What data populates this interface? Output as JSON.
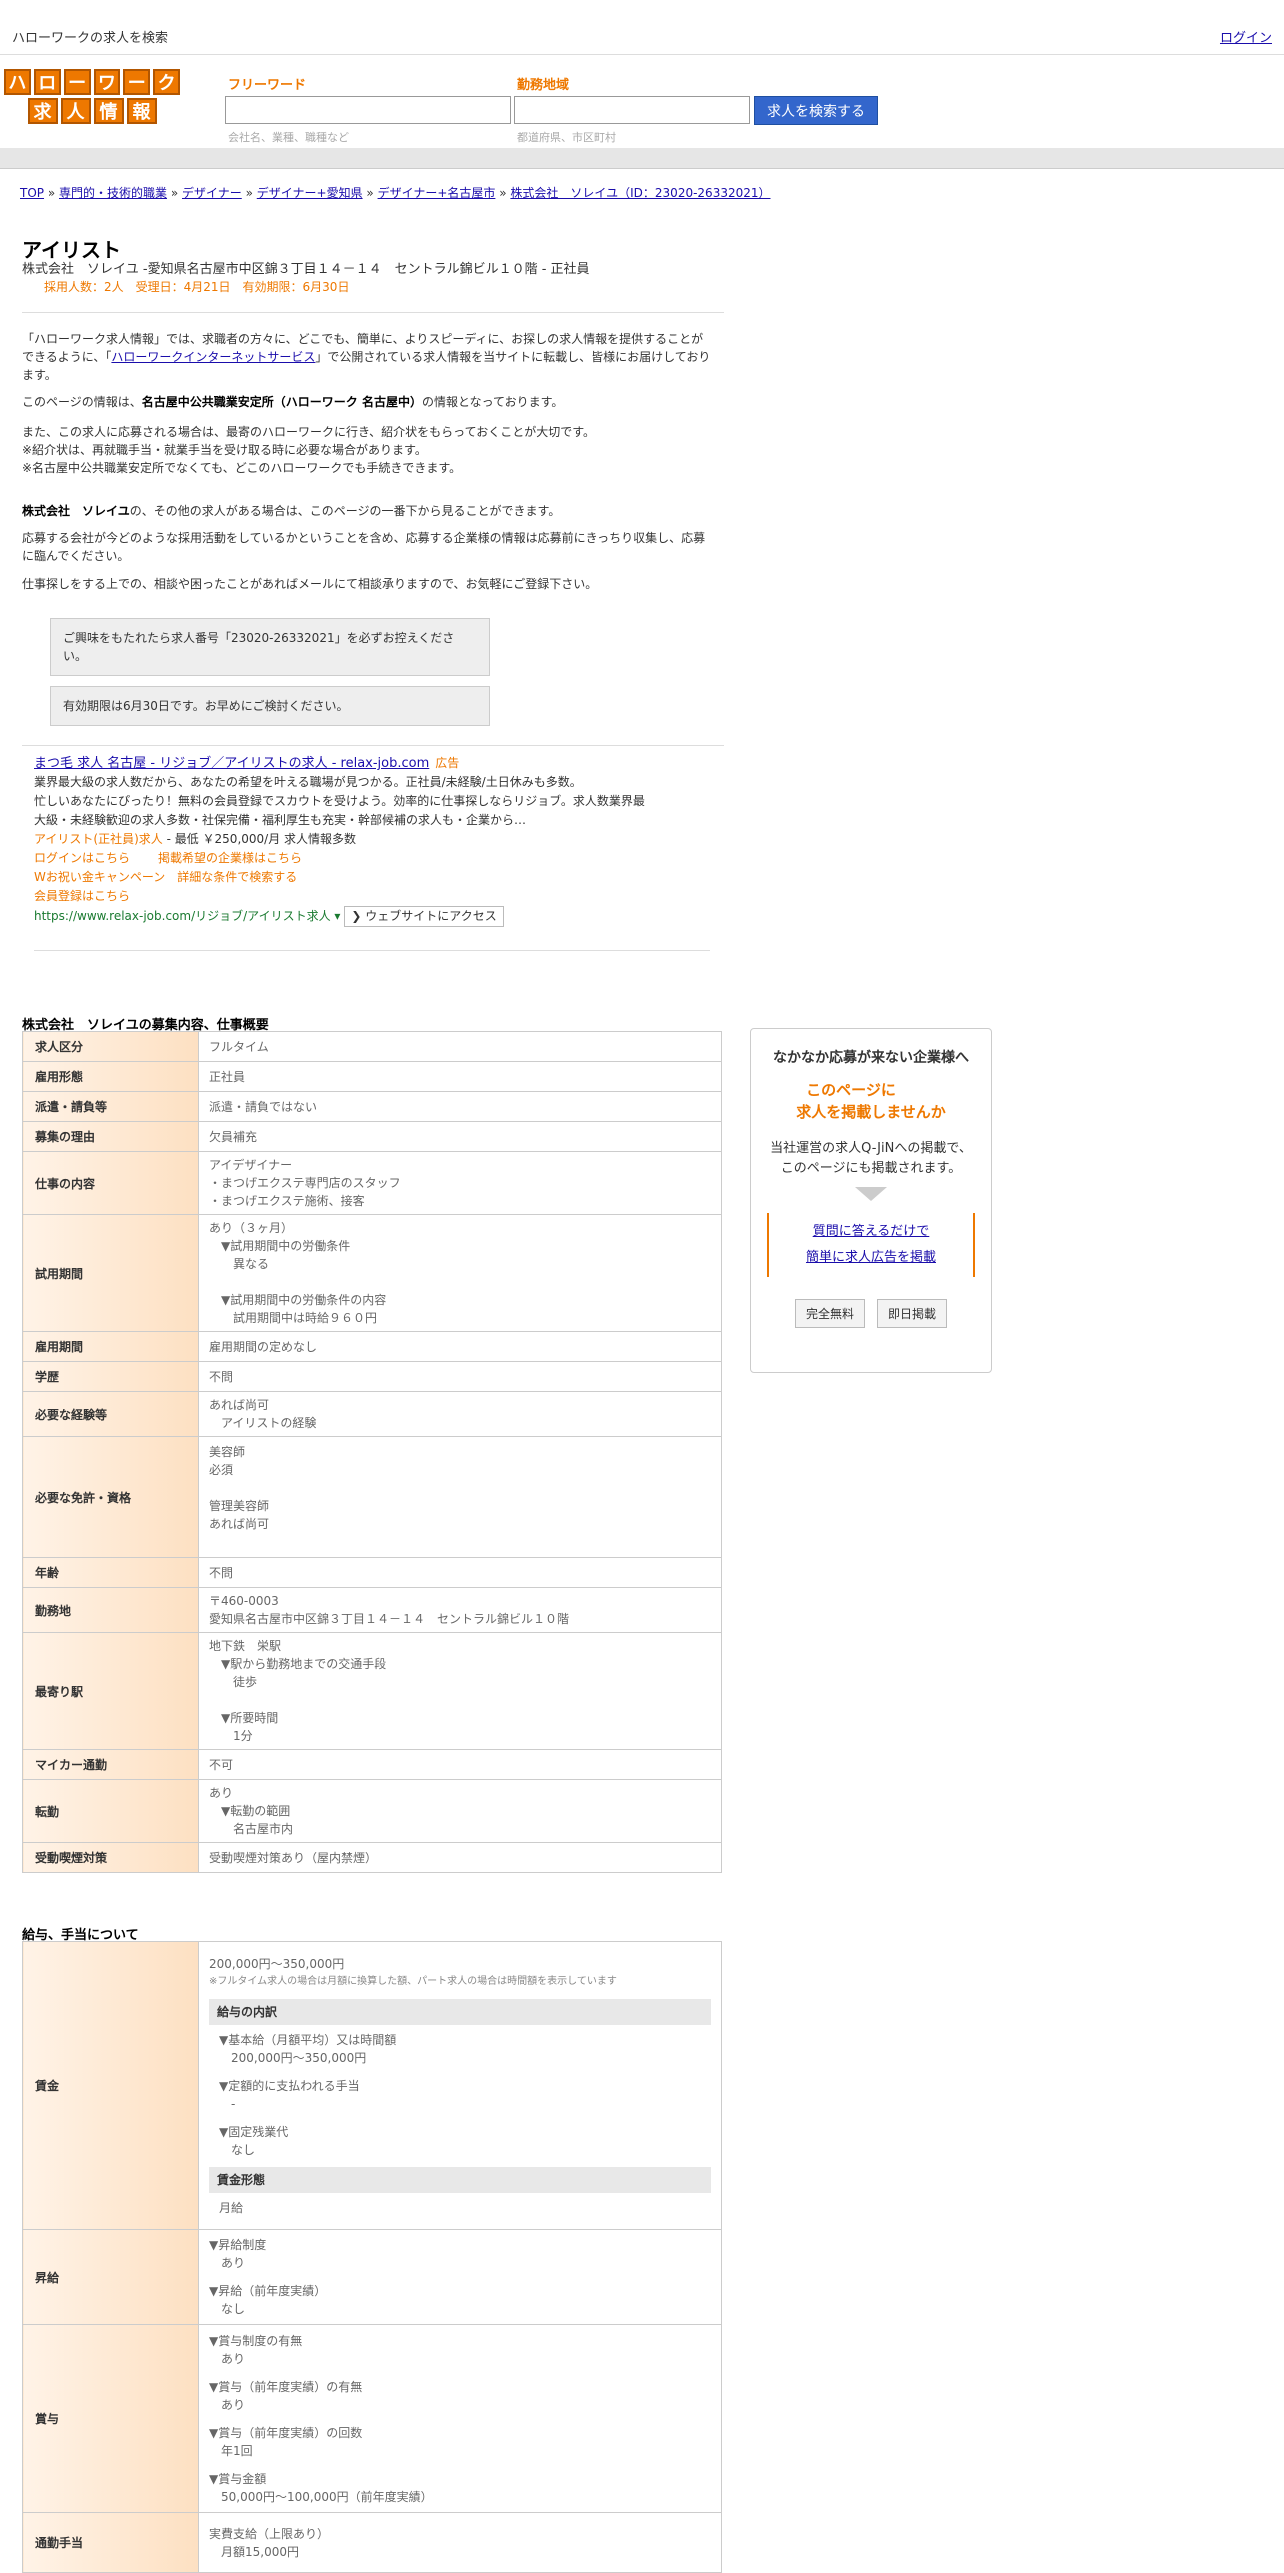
{
  "topbar": {
    "title": "ハローワークの求人を検索",
    "login": "ログイン"
  },
  "logo": {
    "row1": [
      "ハ",
      "ロ",
      "ー",
      "ワ",
      "ー",
      "ク"
    ],
    "row2": [
      "求",
      "人",
      "情",
      "報"
    ]
  },
  "search": {
    "keyword_label": "フリーワード",
    "keyword_placeholder": "会社名、業種、職種など",
    "area_label": "勤務地域",
    "area_placeholder": "都道府県、市区町村",
    "button": "求人を検索する"
  },
  "breadcrumb": [
    "TOP",
    "専門的・技術的職業",
    "デザイナー",
    "デザイナー+愛知県",
    "デザイナー+名古屋市",
    "株式会社　ソレイユ（ID：23020-26332021）"
  ],
  "job": {
    "title": "アイリスト",
    "company": "株式会社　ソレイユ -愛知県名古屋市中区錦３丁目１４－１４　セントラル錦ビル１０階 - 正社員",
    "meta": "採用人数：2人　受理日：4月21日　有効期限：6月30日"
  },
  "intro": {
    "p1_a": "「ハローワーク求人情報」では、求職者の方々に、どこでも、簡単に、よりスピーディに、お探しの求人情報を提供することができるように、「",
    "p1_link": "ハローワークインターネットサービス",
    "p1_b": "」で公開されている求人情報を当サイトに転載し、皆様にお届けしております。",
    "p2_a": "このページの情報は、",
    "p2_b": "名古屋中公共職業安定所（ハローワーク 名古屋中）",
    "p2_c": "の情報となっております。",
    "p3_1": "また、この求人に応募される場合は、最寄のハローワークに行き、紹介状をもらっておくことが大切です。",
    "p3_2": "※紹介状は、再就職手当・就業手当を受け取る時に必要な場合があります。",
    "p3_3": "※名古屋中公共職業安定所でなくても、どこのハローワークでも手続きできます。",
    "p4_a": "株式会社　ソレイユ",
    "p4_b": "の、その他の求人がある場合は、このページの一番下から見ることができます。",
    "p5": "応募する会社が今どのような採用活動をしているかということを含め、応募する企業様の情報は応募前にきっちり収集し、応募に臨んでください。",
    "p6": "仕事探しをする上での、相談や困ったことがあればメールにて相談承りますので、お気軽にご登録下さい。",
    "note1": "ご興味をもたれたら求人番号「23020-26332021」を必ずお控えください。",
    "note2": "有効期限は6月30日です。お早めにご検討ください。"
  },
  "ad": {
    "title": "まつ毛 求人 名古屋 - リジョブ／アイリストの求人 - relax-job.com",
    "tag": "広告",
    "body1": "業界最大級の求人数だから、あなたの希望を叶える職場が見つかる。正社員/未経験/土日休みも多数。",
    "body2": "忙しいあなたにぴったり！無料の会員登録でスカウトを受けよう。効率的に仕事探しならリジョブ。求人数業界最大級・未経験歓迎の求人多数・社保完備・福利厚生も充実・幹部候補の求人も・企業から…",
    "line3_a": "アイリスト(正社員)求人",
    "line3_b": " - 最低 ￥250,000/月 求人情報多数",
    "links": [
      "ログインはこちら",
      "掲載希望の企業様はこちら",
      "Wお祝い金キャンペーン",
      "詳細な条件で検索する",
      "会員登録はこちら"
    ],
    "url": "https://www.relax-job.com/リジョブ/アイリスト求人",
    "webbtn": "❯ ウェブサイトにアクセス"
  },
  "section1": {
    "title": "株式会社　ソレイユの募集内容、仕事概要",
    "rows": [
      {
        "k": "求人区分",
        "v": [
          "フルタイム"
        ]
      },
      {
        "k": "雇用形態",
        "v": [
          "正社員"
        ]
      },
      {
        "k": "派遣・請負等",
        "v": [
          "派遣・請負ではない"
        ]
      },
      {
        "k": "募集の理由",
        "v": [
          "欠員補充"
        ]
      },
      {
        "k": "仕事の内容",
        "v": [
          "アイデザイナー",
          "・まつげエクステ専門店のスタッフ",
          "・まつげエクステ施術、接客"
        ]
      },
      {
        "k": "試用期間",
        "v": [
          "あり（３ヶ月）",
          "　▼試用期間中の労働条件",
          "　　異なる",
          "",
          "　▼試用期間中の労働条件の内容",
          "　　試用期間中は時給９６０円"
        ]
      },
      {
        "k": "雇用期間",
        "v": [
          "雇用期間の定めなし"
        ]
      },
      {
        "k": "学歴",
        "v": [
          "不問"
        ]
      },
      {
        "k": "必要な経験等",
        "v": [
          "あれば尚可",
          "　アイリストの経験"
        ]
      },
      {
        "k": "必要な免許・資格",
        "v": [
          "美容師",
          "必須",
          "",
          "管理美容師",
          "あれば尚可",
          ""
        ]
      },
      {
        "k": "年齢",
        "v": [
          "不問"
        ]
      },
      {
        "k": "勤務地",
        "v": [
          "〒460-0003",
          "愛知県名古屋市中区錦３丁目１４－１４　セントラル錦ビル１０階"
        ]
      },
      {
        "k": "最寄り駅",
        "v": [
          "地下鉄　栄駅",
          "　▼駅から勤務地までの交通手段",
          "　　徒歩",
          "",
          "　▼所要時間",
          "　　1分"
        ]
      },
      {
        "k": "マイカー通勤",
        "v": [
          "不可"
        ]
      },
      {
        "k": "転勤",
        "v": [
          "あり",
          "　▼転勤の範囲",
          "　　名古屋市内"
        ]
      },
      {
        "k": "受動喫煙対策",
        "v": [
          "受動喫煙対策あり（屋内禁煙）"
        ]
      }
    ]
  },
  "section2": {
    "title": "給与、手当について",
    "wage_label": "賃金",
    "wage_range": "200,000円〜350,000円",
    "wage_note": "※フルタイム求人の場合は月額に換算した額、パート求人の場合は時間額を表示しています",
    "breakdown_head": "給与の内訳",
    "breakdown": [
      "▼基本給（月額平均）又は時間額",
      "　200,000円〜350,000円",
      "",
      "▼定額的に支払われる手当",
      "　-",
      "",
      "▼固定残業代",
      "　なし"
    ],
    "form_head": "賃金形態",
    "form_value": "月給",
    "raise_label": "昇給",
    "raise": [
      "▼昇給制度",
      "　あり",
      "",
      "▼昇給（前年度実績）",
      "　なし"
    ],
    "bonus_label": "賞与",
    "bonus": [
      "▼賞与制度の有無",
      "　あり",
      "",
      "▼賞与（前年度実績）の有無",
      "　あり",
      "",
      "▼賞与（前年度実績）の回数",
      "　年1回",
      "",
      "▼賞与金額",
      "　50,000円〜100,000円（前年度実績）"
    ],
    "commute_label": "通勤手当",
    "commute": [
      "実費支給（上限あり）",
      "　月額15,000円"
    ]
  },
  "sidebox": {
    "head": "なかなか応募が来ない企業様へ",
    "orange1": "このページに",
    "orange2": "求人を掲載しませんか",
    "p1": "当社運営の求人Q-JiNへの掲載で、",
    "p2": "このページにも掲載されます。",
    "link1": "質問に答えるだけで",
    "link2": "簡単に求人広告を掲載",
    "btn1": "完全無料",
    "btn2": "即日掲載"
  }
}
